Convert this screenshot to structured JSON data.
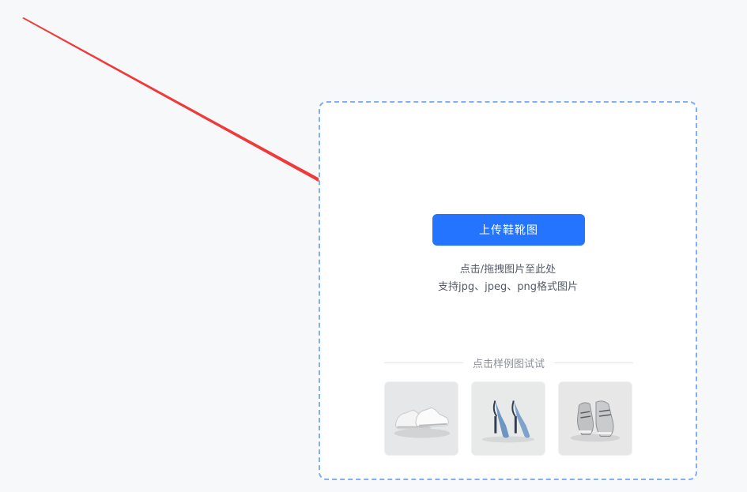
{
  "upload": {
    "button_label": "上传鞋靴图",
    "hint_line1": "点击/拖拽图片至此处",
    "hint_line2": "支持jpg、jpeg、png格式图片"
  },
  "samples": {
    "heading": "点击样例图试试",
    "items": [
      {
        "icon": "white-sneakers-icon"
      },
      {
        "icon": "blue-heels-icon"
      },
      {
        "icon": "grey-running-shoes-icon"
      }
    ]
  },
  "colors": {
    "accent": "#2474ff",
    "dashed_border": "#7fb0f5",
    "arrow": "#f03a3a",
    "background": "#f7f8fa"
  }
}
